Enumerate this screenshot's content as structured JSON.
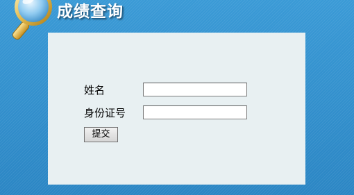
{
  "header": {
    "icon": "magnifier-icon",
    "title": "成绩查询"
  },
  "form": {
    "fields": [
      {
        "label": "姓名",
        "value": "",
        "placeholder": ""
      },
      {
        "label": "身份证号",
        "value": "",
        "placeholder": ""
      }
    ],
    "submit_label": "提交"
  },
  "colors": {
    "background": "#2f8cc9",
    "panel": "#e8f0f2",
    "title_text": "#ffffff"
  }
}
